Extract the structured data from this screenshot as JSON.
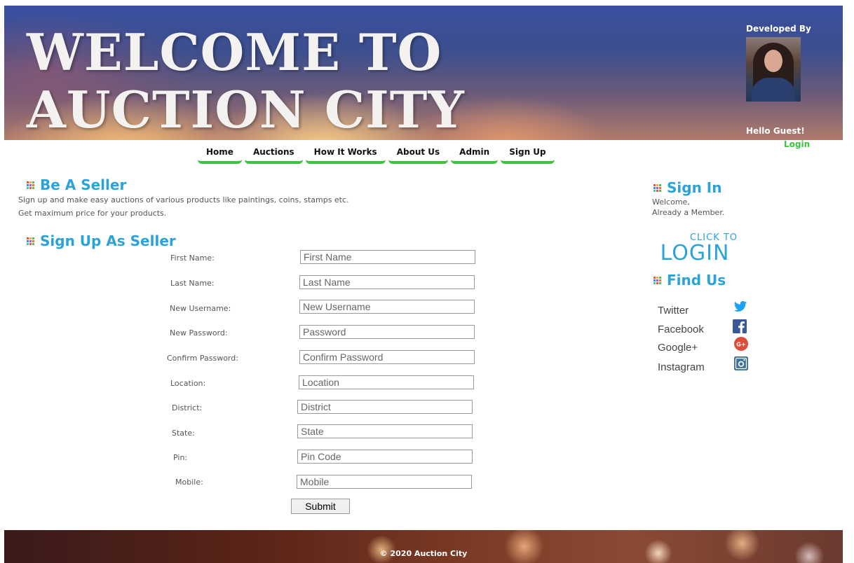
{
  "header": {
    "title": "WELCOME TO AUCTION CITY",
    "developed_by": "Developed By",
    "greeting": "Hello Guest!",
    "login_link": "Login"
  },
  "nav": {
    "items": [
      "Home",
      "Auctions",
      "How It Works",
      "About Us",
      "Admin",
      "Sign Up"
    ]
  },
  "seller": {
    "heading": "Be A Seller",
    "line1": "Sign up and make easy auctions of various products like paintings, coins, stamps etc.",
    "line2": "Get maximum price for your products."
  },
  "signup": {
    "heading": "Sign Up As Seller",
    "fields": [
      {
        "label": "First Name:",
        "placeholder": "First Name"
      },
      {
        "label": "Last Name:",
        "placeholder": "Last Name"
      },
      {
        "label": "New Username:",
        "placeholder": "New Username"
      },
      {
        "label": "New Password:",
        "placeholder": "Password"
      },
      {
        "label": "Confirm Password:",
        "placeholder": "Confirm Password"
      },
      {
        "label": "Location:",
        "placeholder": "Location"
      },
      {
        "label": "District:",
        "placeholder": "District"
      },
      {
        "label": "State:",
        "placeholder": "State"
      },
      {
        "label": "Pin:",
        "placeholder": "Pin Code"
      },
      {
        "label": "Mobile:",
        "placeholder": "Mobile"
      }
    ],
    "submit": "Submit"
  },
  "signin": {
    "heading": "Sign In",
    "line1": "Welcome,",
    "line2": "Already a Member.",
    "click_to": "CLICK TO",
    "login": "LOGIN"
  },
  "findus": {
    "heading": "Find Us",
    "links": [
      {
        "name": "Twitter",
        "icon": "twitter-icon",
        "color": "#1da1f2"
      },
      {
        "name": "Facebook",
        "icon": "facebook-icon",
        "color": "#3b5998"
      },
      {
        "name": "Google+",
        "icon": "google-plus-icon",
        "color": "#dd4b39"
      },
      {
        "name": "Instagram",
        "icon": "instagram-icon",
        "color": "#3f729b"
      }
    ]
  },
  "footer": {
    "copyright": "© 2020 Auction City"
  },
  "colors": {
    "accent": "#2ba3d6",
    "nav_underline": "#3cc43c"
  }
}
